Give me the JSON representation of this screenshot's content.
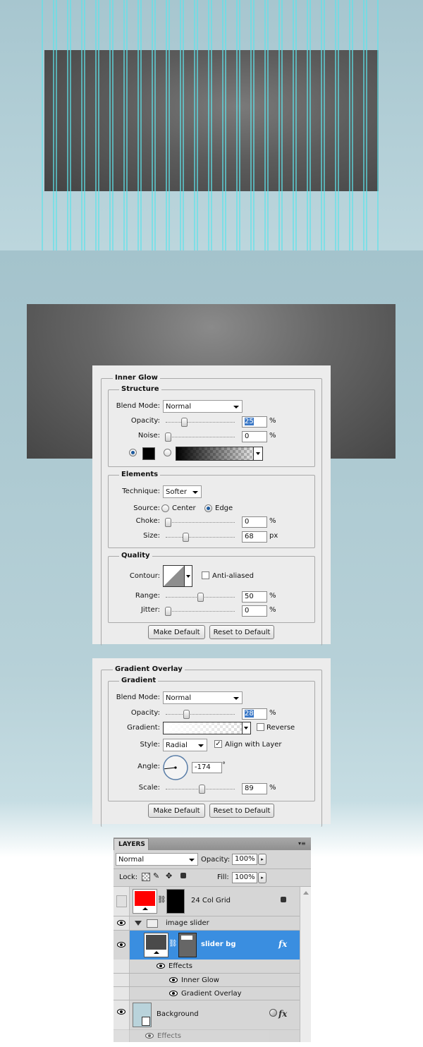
{
  "inner_glow": {
    "title": "Inner Glow",
    "structure": {
      "title": "Structure",
      "blend_mode_label": "Blend Mode:",
      "blend_mode": "Normal",
      "opacity_label": "Opacity:",
      "opacity": "25",
      "opacity_unit": "%",
      "opacity_level": 0.25,
      "noise_label": "Noise:",
      "noise": "0",
      "noise_unit": "%",
      "noise_level": 0.0,
      "color": "#000000"
    },
    "elements": {
      "title": "Elements",
      "technique_label": "Technique:",
      "technique": "Softer",
      "source_label": "Source:",
      "source_center": "Center",
      "source_edge": "Edge",
      "choke_label": "Choke:",
      "choke": "0",
      "choke_unit": "%",
      "choke_level": 0.0,
      "size_label": "Size:",
      "size": "68",
      "size_unit": "px",
      "size_level": 0.27
    },
    "quality": {
      "title": "Quality",
      "contour_label": "Contour:",
      "anti_aliased": "Anti-aliased",
      "range_label": "Range:",
      "range": "50",
      "range_unit": "%",
      "range_level": 0.5,
      "jitter_label": "Jitter:",
      "jitter": "0",
      "jitter_unit": "%",
      "jitter_level": 0.0
    },
    "make_default": "Make Default",
    "reset_default": "Reset to Default"
  },
  "gradient_overlay": {
    "title": "Gradient Overlay",
    "gradient": {
      "title": "Gradient",
      "blend_mode_label": "Blend Mode:",
      "blend_mode": "Normal",
      "opacity_label": "Opacity:",
      "opacity": "28",
      "opacity_unit": "%",
      "opacity_level": 0.28,
      "gradient_label": "Gradient:",
      "reverse": "Reverse",
      "style_label": "Style:",
      "style": "Radial",
      "align_with_layer": "Align with Layer",
      "angle_label": "Angle:",
      "angle": "-174",
      "angle_unit": "°",
      "scale_label": "Scale:",
      "scale": "89",
      "scale_unit": "%",
      "scale_level": 0.52
    },
    "make_default": "Make Default",
    "reset_default": "Reset to Default"
  },
  "layers": {
    "tab": "LAYERS",
    "blend_mode": "Normal",
    "opacity_label": "Opacity:",
    "opacity": "100%",
    "lock_label": "Lock:",
    "fill_label": "Fill:",
    "fill": "100%",
    "rows": [
      {
        "name": "24 Col Grid",
        "thumb_color": "#ff0000"
      },
      {
        "name": "image slider"
      },
      {
        "name": "slider bg",
        "fx": "fx"
      },
      {
        "name": "Effects"
      },
      {
        "name": "Inner Glow"
      },
      {
        "name": "Gradient Overlay"
      },
      {
        "name": "Background",
        "fx": "fx"
      },
      {
        "name": "Effects"
      }
    ]
  },
  "colors": {
    "guide": "#5fe3ea",
    "selection": "#3a8ee0",
    "dark_slider": "#4a4a4a"
  }
}
